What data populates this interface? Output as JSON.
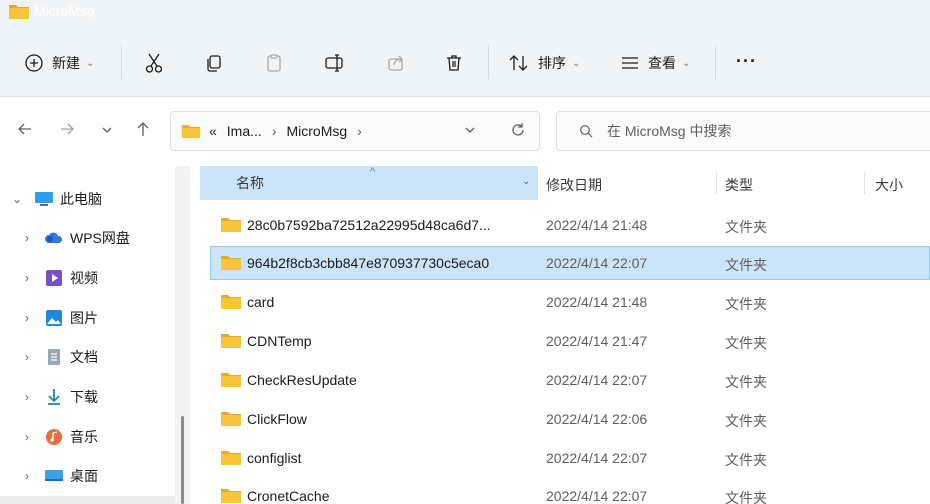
{
  "window": {
    "title": "MicroMsg"
  },
  "toolbar": {
    "new_label": "新建",
    "sort_label": "排序",
    "view_label": "查看",
    "more_label": "···"
  },
  "address": {
    "prefix": "«",
    "crumbs": [
      "Ima...",
      "MicroMsg"
    ],
    "search_placeholder": "在 MicroMsg 中搜索"
  },
  "sidebar": {
    "items": [
      {
        "label": "此电脑",
        "icon": "computer-icon",
        "expand": "down"
      },
      {
        "label": "WPS网盘",
        "icon": "cloud-icon",
        "expand": "right"
      },
      {
        "label": "视频",
        "icon": "video-icon",
        "expand": "right"
      },
      {
        "label": "图片",
        "icon": "pictures-icon",
        "expand": "right"
      },
      {
        "label": "文档",
        "icon": "document-icon",
        "expand": "right"
      },
      {
        "label": "下载",
        "icon": "download-icon",
        "expand": "right"
      },
      {
        "label": "音乐",
        "icon": "music-icon",
        "expand": "right"
      },
      {
        "label": "桌面",
        "icon": "desktop-icon",
        "expand": "right"
      }
    ]
  },
  "columns": {
    "name": "名称",
    "modified": "修改日期",
    "type": "类型",
    "size": "大小"
  },
  "files": [
    {
      "name": "28c0b7592ba72512a22995d48ca6d7...",
      "date": "2022/4/14 21:48",
      "type": "文件夹"
    },
    {
      "name": "964b2f8cb3cbb847e870937730c5eca0",
      "date": "2022/4/14 22:07",
      "type": "文件夹",
      "selected": true
    },
    {
      "name": "card",
      "date": "2022/4/14 21:48",
      "type": "文件夹"
    },
    {
      "name": "CDNTemp",
      "date": "2022/4/14 21:47",
      "type": "文件夹"
    },
    {
      "name": "CheckResUpdate",
      "date": "2022/4/14 22:07",
      "type": "文件夹"
    },
    {
      "name": "ClickFlow",
      "date": "2022/4/14 22:06",
      "type": "文件夹"
    },
    {
      "name": "configlist",
      "date": "2022/4/14 22:07",
      "type": "文件夹"
    },
    {
      "name": "CronetCache",
      "date": "2022/4/14 22:07",
      "type": "文件夹"
    }
  ],
  "colors": {
    "accent_selection": "#cce4f7",
    "folder_yellow": "#f8c43a"
  }
}
